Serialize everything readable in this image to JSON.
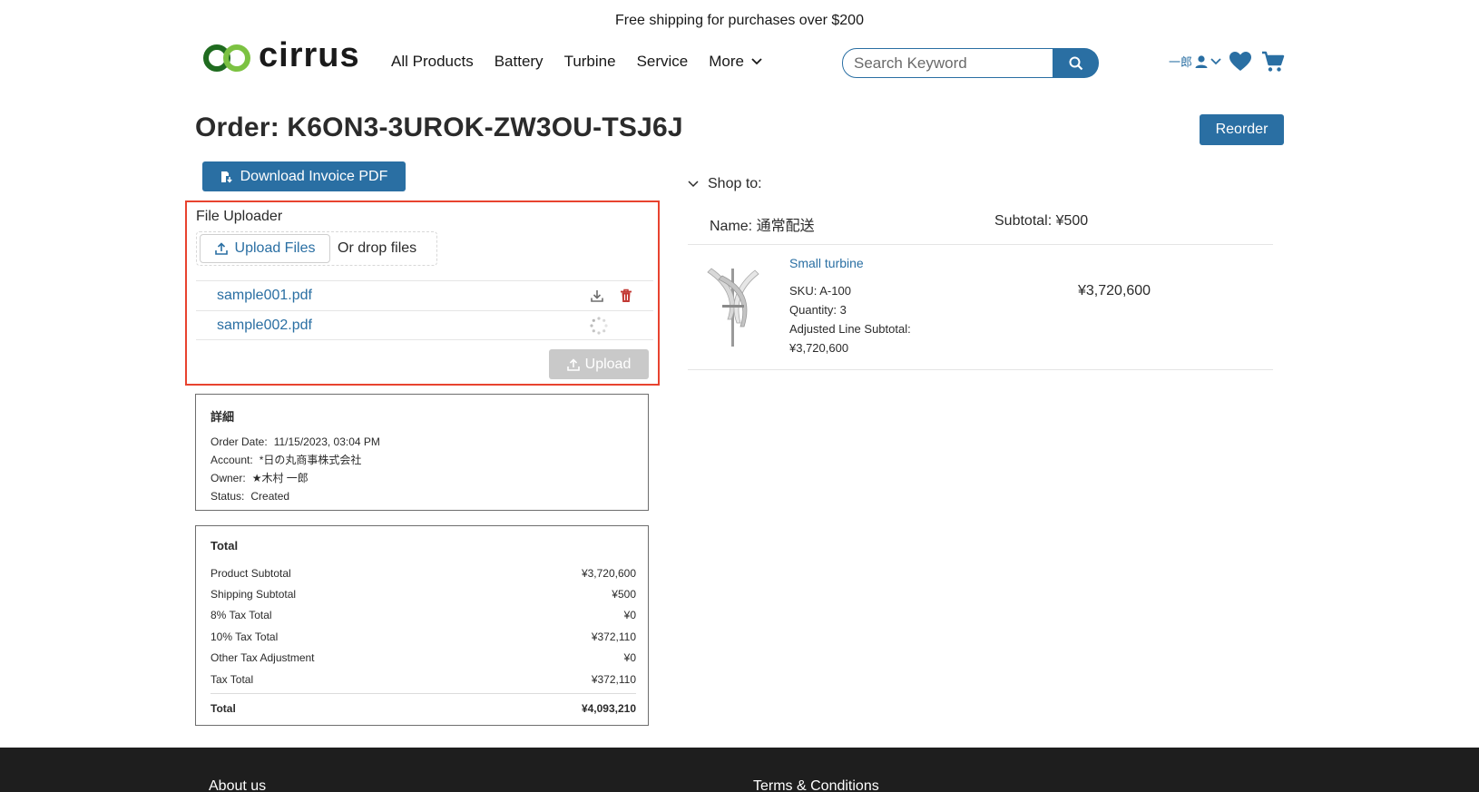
{
  "promo": {
    "text": "Free shipping for purchases over $200"
  },
  "header": {
    "logo_text": "cirrus",
    "nav": [
      "All Products",
      "Battery",
      "Turbine",
      "Service",
      "More"
    ],
    "search_placeholder": "Search Keyword",
    "user_name": "一郎"
  },
  "colors": {
    "accent": "#2a6fa3",
    "logo_dark": "#1f6b1f",
    "logo_light": "#7cc242",
    "highlight": "#e8432f",
    "footer": "#1e1e1e"
  },
  "order": {
    "title": "Order: K6ON3-3UROK-ZW3OU-TSJ6J",
    "reorder_label": "Reorder",
    "invoice_label": "Download Invoice PDF"
  },
  "uploader": {
    "label": "File Uploader",
    "upload_files_label": "Upload Files",
    "drop_text": "Or drop files",
    "files": [
      {
        "name": "sample001.pdf",
        "state": "uploaded"
      },
      {
        "name": "sample002.pdf",
        "state": "loading"
      }
    ],
    "upload_label": "Upload"
  },
  "details": {
    "title": "詳細",
    "rows": [
      {
        "k": "Order Date:",
        "v": "11/15/2023, 03:04 PM"
      },
      {
        "k": "Account:",
        "v": "*日の丸商事株式会社"
      },
      {
        "k": "Owner:",
        "v": "★木村 一郎"
      },
      {
        "k": "Status:",
        "v": "Created"
      }
    ]
  },
  "totals": {
    "title": "Total",
    "rows": [
      {
        "k": "Product Subtotal",
        "v": "¥3,720,600"
      },
      {
        "k": "Shipping Subtotal",
        "v": "¥500"
      },
      {
        "k": "8% Tax Total",
        "v": "¥0"
      },
      {
        "k": "10% Tax Total",
        "v": "¥372,110"
      },
      {
        "k": "Other Tax Adjustment",
        "v": "¥0"
      },
      {
        "k": "Tax Total",
        "v": "¥372,110"
      }
    ],
    "final": {
      "k": "Total",
      "v": "¥4,093,210"
    }
  },
  "shipto": {
    "heading": "Shop to:",
    "name": "Name: 通常配送",
    "subtotal": "Subtotal: ¥500",
    "product": {
      "name": "Small turbine",
      "sku": "SKU: A-100",
      "quantity": "Quantity: 3",
      "adjusted_label": "Adjusted Line Subtotal:",
      "adjusted_value": "¥3,720,600",
      "price": "¥3,720,600"
    }
  },
  "footer": {
    "about": "About us",
    "terms": "Terms & Conditions"
  }
}
